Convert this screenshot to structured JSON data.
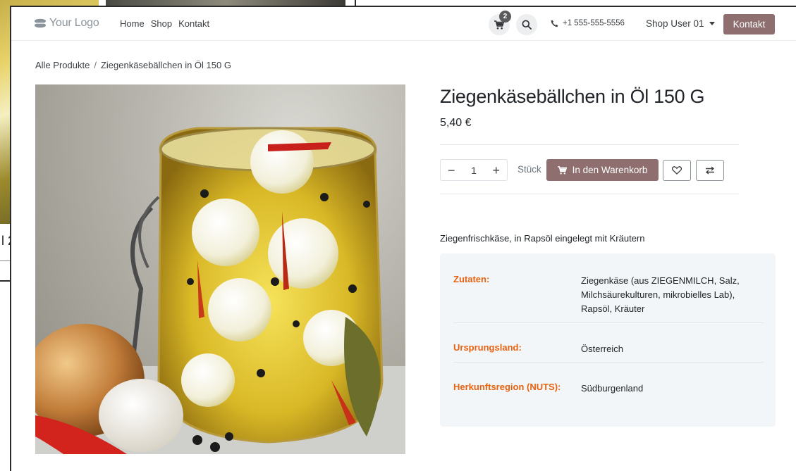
{
  "background_window": {
    "partial_text": "l 2"
  },
  "header": {
    "logo_text": "Your Logo",
    "nav": [
      "Home",
      "Shop",
      "Kontakt"
    ],
    "cart_count": "2",
    "phone": "+1 555-555-5556",
    "user_menu": "Shop User 01",
    "contact_button": "Kontakt"
  },
  "breadcrumb": {
    "parent": "Alle Produkte",
    "separator": "/",
    "current": "Ziegenkäsebällchen in Öl 150 G"
  },
  "product": {
    "title": "Ziegenkäsebällchen in Öl 150 G",
    "price": "5,40 €",
    "quantity": "1",
    "unit": "Stück",
    "add_to_cart": "In den Warenkorb",
    "description": "Ziegenfrischkäse, in Rapsöl eingelegt mit Kräutern",
    "details": [
      {
        "label": "Zutaten:",
        "value": "Ziegenkäse (aus ZIEGENMILCH, Salz, Milchsäurekulturen, mikrobielles Lab), Rapsöl, Kräuter"
      },
      {
        "label": "Ursprungsland:",
        "value": "Österreich"
      },
      {
        "label": "Herkunftsregion (NUTS):",
        "value": "Südburgenland"
      }
    ]
  },
  "colors": {
    "primary": "#8e6e6e",
    "detail_label": "#e8620f",
    "info_box_bg": "#f3f6f8"
  },
  "icons": {
    "cart": "shopping-cart-icon",
    "search": "search-icon",
    "phone": "phone-icon",
    "wishlist": "heart-icon",
    "compare": "compare-arrows-icon",
    "dropdown": "caret-down-icon"
  }
}
